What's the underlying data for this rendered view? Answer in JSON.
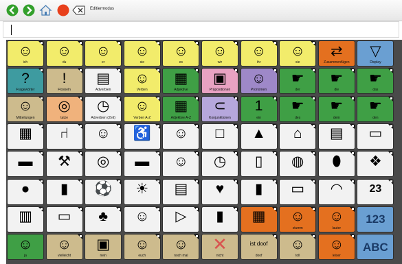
{
  "toolbar": {
    "edit_label": "Editiermodus",
    "buttons": [
      {
        "name": "back-icon",
        "glyph": "❮",
        "color": "#33a02c"
      },
      {
        "name": "forward-icon",
        "glyph": "❯",
        "color": "#33a02c"
      },
      {
        "name": "home-icon",
        "glyph": "⌂",
        "color": "#4a7fb5"
      },
      {
        "name": "stop-icon",
        "glyph": "",
        "color": "#e8401c"
      },
      {
        "name": "delete-icon",
        "glyph": "⌫",
        "color": "#333333"
      }
    ]
  },
  "text_bar": {
    "value": ""
  },
  "colors": {
    "yellow": "#f2ec6b",
    "khaki": "#cdbb8d",
    "orange": "#e4701f",
    "blue": "#6a9fd2",
    "green": "#3f9f45",
    "white": "#f2f2f2",
    "teal": "#3e9ba0",
    "pink": "#e8a2c2",
    "purple": "#9e88c8",
    "lavender": "#b6a7dc",
    "peach": "#f0b27c"
  },
  "grid": {
    "rows": [
      [
        {
          "label": "ich",
          "icon": "☺",
          "bg": "yellow",
          "corner": true
        },
        {
          "label": "du",
          "icon": "☺",
          "bg": "yellow",
          "corner": true
        },
        {
          "label": "er",
          "icon": "☺",
          "bg": "yellow",
          "corner": true
        },
        {
          "label": "sie",
          "icon": "☺",
          "bg": "yellow",
          "corner": true
        },
        {
          "label": "es",
          "icon": "☺",
          "bg": "yellow",
          "corner": true
        },
        {
          "label": "wir",
          "icon": "☺",
          "bg": "yellow",
          "corner": true
        },
        {
          "label": "ihr",
          "icon": "☺",
          "bg": "yellow",
          "corner": true
        },
        {
          "label": "sie",
          "icon": "☺",
          "bg": "yellow",
          "corner": true
        },
        {
          "label": "Zusammenfügen",
          "icon": "⇄",
          "bg": "orange",
          "corner": false
        },
        {
          "label": "Display",
          "icon": "▽",
          "bg": "blue",
          "corner": false
        }
      ],
      [
        {
          "label": "Fragewörter",
          "icon": "?",
          "bg": "teal",
          "corner": true
        },
        {
          "label": "Floskeln",
          "icon": "!",
          "bg": "khaki",
          "corner": true
        },
        {
          "label": "Adverbien",
          "icon": "▤",
          "bg": "white",
          "corner": true
        },
        {
          "label": "Verben",
          "icon": "☺",
          "bg": "yellow",
          "corner": true
        },
        {
          "label": "Adjektive",
          "icon": "▦",
          "bg": "green",
          "corner": true
        },
        {
          "label": "Präpositionen",
          "icon": "▣",
          "bg": "pink",
          "corner": true
        },
        {
          "label": "Pronomen",
          "icon": "☺",
          "bg": "purple",
          "corner": true
        },
        {
          "label": "der",
          "icon": "☛",
          "bg": "green",
          "corner": true
        },
        {
          "label": "die",
          "icon": "☛",
          "bg": "green",
          "corner": true
        },
        {
          "label": "das",
          "icon": "☛",
          "bg": "green",
          "corner": true
        }
      ],
      [
        {
          "label": "Mitteilungen",
          "icon": "☺",
          "bg": "khaki",
          "corner": true
        },
        {
          "label": "tatze",
          "icon": "◎",
          "bg": "peach",
          "corner": true
        },
        {
          "label": "Adverbien (Zeit)",
          "icon": "◷",
          "bg": "white",
          "corner": true
        },
        {
          "label": "Verben A-Z",
          "icon": "☺",
          "bg": "yellow",
          "corner": true
        },
        {
          "label": "Adjektive A-Z",
          "icon": "▦",
          "bg": "green",
          "corner": true
        },
        {
          "label": "Konjunktionen",
          "icon": "⊂",
          "bg": "lavender",
          "corner": true
        },
        {
          "label": "ein",
          "icon": "1",
          "bg": "green",
          "corner": true
        },
        {
          "label": "des",
          "icon": "☛",
          "bg": "green",
          "corner": true
        },
        {
          "label": "dem",
          "icon": "☛",
          "bg": "green",
          "corner": true
        },
        {
          "label": "den",
          "icon": "☛",
          "bg": "green",
          "corner": true
        }
      ],
      [
        {
          "label": "",
          "icon": "▦",
          "bg": "white",
          "corner": true
        },
        {
          "label": "",
          "icon": "⑁",
          "bg": "white",
          "corner": true
        },
        {
          "label": "",
          "icon": "☺",
          "bg": "white",
          "corner": true
        },
        {
          "label": "",
          "icon": "♿",
          "bg": "white",
          "corner": true
        },
        {
          "label": "",
          "icon": "☺",
          "bg": "white",
          "corner": true
        },
        {
          "label": "",
          "icon": "□",
          "bg": "white",
          "corner": true
        },
        {
          "label": "",
          "icon": "▲",
          "bg": "white",
          "corner": true
        },
        {
          "label": "",
          "icon": "⌂",
          "bg": "white",
          "corner": true
        },
        {
          "label": "",
          "icon": "▤",
          "bg": "white",
          "corner": true
        },
        {
          "label": "",
          "icon": "▭",
          "bg": "white",
          "corner": true
        }
      ],
      [
        {
          "label": "",
          "icon": "▬",
          "bg": "white",
          "corner": true
        },
        {
          "label": "",
          "icon": "⚒",
          "bg": "white",
          "corner": true
        },
        {
          "label": "",
          "icon": "◎",
          "bg": "white",
          "corner": true
        },
        {
          "label": "",
          "icon": "▬",
          "bg": "white",
          "corner": true
        },
        {
          "label": "",
          "icon": "☺",
          "bg": "white",
          "corner": true
        },
        {
          "label": "",
          "icon": "◷",
          "bg": "white",
          "corner": true
        },
        {
          "label": "",
          "icon": "▯",
          "bg": "white",
          "corner": true
        },
        {
          "label": "",
          "icon": "◍",
          "bg": "white",
          "corner": true
        },
        {
          "label": "",
          "icon": "⬮",
          "bg": "white",
          "corner": true
        },
        {
          "label": "",
          "icon": "❖",
          "bg": "white",
          "corner": true
        }
      ],
      [
        {
          "label": "",
          "icon": "●",
          "bg": "white",
          "corner": true
        },
        {
          "label": "",
          "icon": "▮",
          "bg": "white",
          "corner": true
        },
        {
          "label": "",
          "icon": "⚽",
          "bg": "white",
          "corner": true
        },
        {
          "label": "",
          "icon": "☀",
          "bg": "white",
          "corner": true
        },
        {
          "label": "",
          "icon": "▤",
          "bg": "white",
          "corner": true
        },
        {
          "label": "",
          "icon": "♥",
          "bg": "white",
          "corner": true
        },
        {
          "label": "",
          "icon": "▮",
          "bg": "white",
          "corner": true
        },
        {
          "label": "",
          "icon": "▭",
          "bg": "white",
          "corner": true
        },
        {
          "label": "",
          "icon": "◠",
          "bg": "white",
          "corner": true
        },
        {
          "label": "",
          "icon": "23",
          "bg": "white",
          "corner": true
        }
      ],
      [
        {
          "label": "",
          "icon": "▥",
          "bg": "white",
          "corner": true
        },
        {
          "label": "",
          "icon": "▭",
          "bg": "white",
          "corner": true
        },
        {
          "label": "",
          "icon": "♣",
          "bg": "white",
          "corner": true
        },
        {
          "label": "",
          "icon": "☺",
          "bg": "white",
          "corner": true
        },
        {
          "label": "",
          "icon": "▷",
          "bg": "white",
          "corner": true
        },
        {
          "label": "",
          "icon": "▮",
          "bg": "white",
          "corner": true
        },
        {
          "label": "",
          "icon": "▦",
          "bg": "orange",
          "corner": true
        },
        {
          "label": "stumm",
          "icon": "☺",
          "bg": "orange",
          "corner": true
        },
        {
          "label": "lauter",
          "icon": "☺",
          "bg": "orange",
          "corner": true
        },
        {
          "label": "",
          "icon": "123",
          "bg": "blue",
          "corner": false
        }
      ],
      [
        {
          "label": "ja",
          "icon": "☺",
          "bg": "green",
          "corner": false
        },
        {
          "label": "vielleicht",
          "icon": "☺",
          "bg": "khaki",
          "corner": true
        },
        {
          "label": "nein",
          "icon": "▣",
          "bg": "khaki",
          "corner": false
        },
        {
          "label": "euch",
          "icon": "☺",
          "bg": "khaki",
          "corner": true
        },
        {
          "label": "noch mal",
          "icon": "☺",
          "bg": "khaki",
          "corner": true
        },
        {
          "label": "nicht",
          "icon": "✕",
          "bg": "khaki",
          "corner": false
        },
        {
          "label": "doof",
          "icon": "ist doof",
          "bg": "khaki",
          "corner": true
        },
        {
          "label": "toll",
          "icon": "☺",
          "bg": "khaki",
          "corner": true
        },
        {
          "label": "leiser",
          "icon": "☺",
          "bg": "orange",
          "corner": true
        },
        {
          "label": "",
          "icon": "ABC",
          "bg": "blue",
          "corner": false
        }
      ]
    ]
  }
}
